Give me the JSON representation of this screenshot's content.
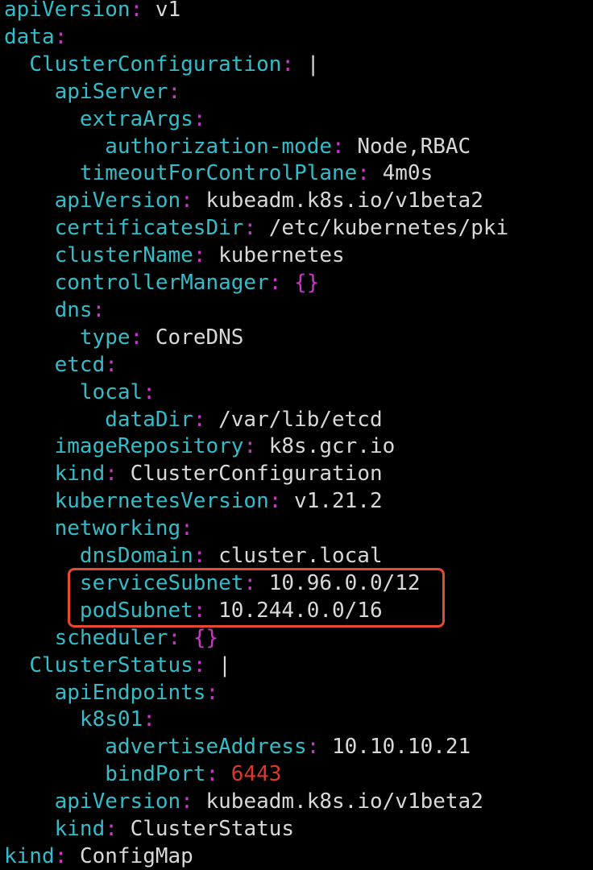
{
  "lines": [
    {
      "indent": "",
      "key": "apiVersion",
      "value": "v1",
      "value_type": "string"
    },
    {
      "indent": "",
      "key": "data",
      "value": "",
      "value_type": "none"
    },
    {
      "indent": "  ",
      "key": "ClusterConfiguration",
      "value": "|",
      "value_type": "string"
    },
    {
      "indent": "    ",
      "key": "apiServer",
      "value": "",
      "value_type": "none"
    },
    {
      "indent": "      ",
      "key": "extraArgs",
      "value": "",
      "value_type": "none"
    },
    {
      "indent": "        ",
      "key": "authorization-mode",
      "value": "Node,RBAC",
      "value_type": "string"
    },
    {
      "indent": "      ",
      "key": "timeoutForControlPlane",
      "value": "4m0s",
      "value_type": "string"
    },
    {
      "indent": "    ",
      "key": "apiVersion",
      "value": "kubeadm.k8s.io/v1beta2",
      "value_type": "string"
    },
    {
      "indent": "    ",
      "key": "certificatesDir",
      "value": "/etc/kubernetes/pki",
      "value_type": "string"
    },
    {
      "indent": "    ",
      "key": "clusterName",
      "value": "kubernetes",
      "value_type": "string"
    },
    {
      "indent": "    ",
      "key": "controllerManager",
      "value": "{}",
      "value_type": "brace"
    },
    {
      "indent": "    ",
      "key": "dns",
      "value": "",
      "value_type": "none"
    },
    {
      "indent": "      ",
      "key": "type",
      "value": "CoreDNS",
      "value_type": "string"
    },
    {
      "indent": "    ",
      "key": "etcd",
      "value": "",
      "value_type": "none"
    },
    {
      "indent": "      ",
      "key": "local",
      "value": "",
      "value_type": "none"
    },
    {
      "indent": "        ",
      "key": "dataDir",
      "value": "/var/lib/etcd",
      "value_type": "string"
    },
    {
      "indent": "    ",
      "key": "imageRepository",
      "value": "k8s.gcr.io",
      "value_type": "string"
    },
    {
      "indent": "    ",
      "key": "kind",
      "value": "ClusterConfiguration",
      "value_type": "string"
    },
    {
      "indent": "    ",
      "key": "kubernetesVersion",
      "value": "v1.21.2",
      "value_type": "string"
    },
    {
      "indent": "    ",
      "key": "networking",
      "value": "",
      "value_type": "none"
    },
    {
      "indent": "      ",
      "key": "dnsDomain",
      "value": "cluster.local",
      "value_type": "string"
    },
    {
      "indent": "      ",
      "key": "serviceSubnet",
      "value": "10.96.0.0/12",
      "value_type": "string"
    },
    {
      "indent": "      ",
      "key": "podSubnet",
      "value": "10.244.0.0/16",
      "value_type": "string"
    },
    {
      "indent": "    ",
      "key": "scheduler",
      "value": "{}",
      "value_type": "brace"
    },
    {
      "indent": "  ",
      "key": "ClusterStatus",
      "value": "|",
      "value_type": "string"
    },
    {
      "indent": "    ",
      "key": "apiEndpoints",
      "value": "",
      "value_type": "none"
    },
    {
      "indent": "      ",
      "key": "k8s01",
      "value": "",
      "value_type": "none"
    },
    {
      "indent": "        ",
      "key": "advertiseAddress",
      "value": "10.10.10.21",
      "value_type": "string"
    },
    {
      "indent": "        ",
      "key": "bindPort",
      "value": "6443",
      "value_type": "number"
    },
    {
      "indent": "    ",
      "key": "apiVersion",
      "value": "kubeadm.k8s.io/v1beta2",
      "value_type": "string"
    },
    {
      "indent": "    ",
      "key": "kind",
      "value": "ClusterStatus",
      "value_type": "string"
    },
    {
      "indent": "",
      "key": "kind",
      "value": "ConfigMap",
      "value_type": "string"
    }
  ],
  "highlight": {
    "color": "#e8482d",
    "covers_keys": [
      "serviceSubnet",
      "podSubnet"
    ]
  },
  "colors": {
    "background": "#000000",
    "key": "#33bcc9",
    "colon": "#c839c5",
    "value": "#d8d8d8",
    "number": "#d83a2a",
    "brace": "#c839c5"
  }
}
